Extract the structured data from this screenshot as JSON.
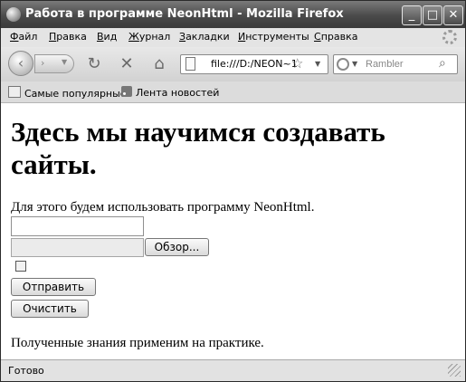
{
  "window": {
    "title": "Работа в программе NeonHtml - Mozilla Firefox"
  },
  "window_controls": {
    "minimize": "_",
    "maximize": "□",
    "close": "✕"
  },
  "menu": [
    "Файл",
    "Правка",
    "Вид",
    "Журнал",
    "Закладки",
    "Инструменты",
    "Справка"
  ],
  "toolbar": {
    "back_icon": "‹",
    "forward_icon": "›",
    "reload_icon": "↻",
    "stop_icon": "✕",
    "home_icon": "⌂",
    "url": "file:///D:/NEON~1",
    "star_icon": "☆",
    "dropdown_icon": "▼",
    "search_placeholder": "Rambler",
    "search_go_icon": "⌕"
  },
  "bookmarks": [
    "Самые популярные",
    "Лента новостей"
  ],
  "page": {
    "heading": "Здесь мы научимся создавать сайты.",
    "paragraph": "Для этого будем использовать программу NeonHtml.",
    "text_input_value": "",
    "file_input_value": "",
    "browse_label": "Обзор...",
    "checkbox_checked": false,
    "submit_label": "Отправить",
    "reset_label": "Очистить",
    "paragraph2": "Полученные знания применим на практике."
  },
  "status": {
    "text": "Готово"
  }
}
